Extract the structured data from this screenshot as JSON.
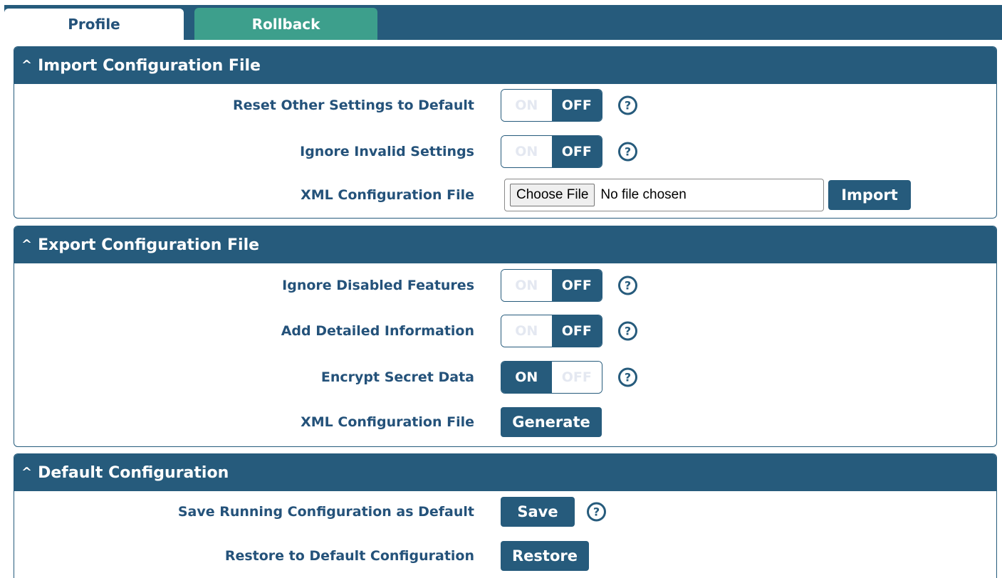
{
  "tabs": [
    {
      "label": "Profile",
      "active": true
    },
    {
      "label": "Rollback",
      "active": false
    }
  ],
  "import_section": {
    "title": "Import Configuration File",
    "reset_other": {
      "label": "Reset Other Settings to Default",
      "on": "ON",
      "off": "OFF",
      "state": "OFF"
    },
    "ignore_invalid": {
      "label": "Ignore Invalid Settings",
      "on": "ON",
      "off": "OFF",
      "state": "OFF"
    },
    "xml_file": {
      "label": "XML Configuration File",
      "choose_label": "Choose File",
      "file_status": "No file chosen",
      "import_label": "Import"
    }
  },
  "export_section": {
    "title": "Export Configuration File",
    "ignore_disabled": {
      "label": "Ignore Disabled Features",
      "on": "ON",
      "off": "OFF",
      "state": "OFF"
    },
    "add_detailed": {
      "label": "Add Detailed Information",
      "on": "ON",
      "off": "OFF",
      "state": "OFF"
    },
    "encrypt_secret": {
      "label": "Encrypt Secret Data",
      "on": "ON",
      "off": "OFF",
      "state": "ON"
    },
    "xml_file": {
      "label": "XML Configuration File",
      "generate_label": "Generate"
    }
  },
  "default_section": {
    "title": "Default Configuration",
    "save_running": {
      "label": "Save Running Configuration as Default",
      "button": "Save"
    },
    "restore": {
      "label": "Restore to Default Configuration",
      "button": "Restore"
    }
  },
  "icons": {
    "collapse": "chevron-up-icon",
    "help": "question-circle-icon"
  },
  "colors": {
    "primary": "#265b7c",
    "tab_secondary": "#3d9f8c",
    "inactive_text": "#e4e8f1"
  }
}
